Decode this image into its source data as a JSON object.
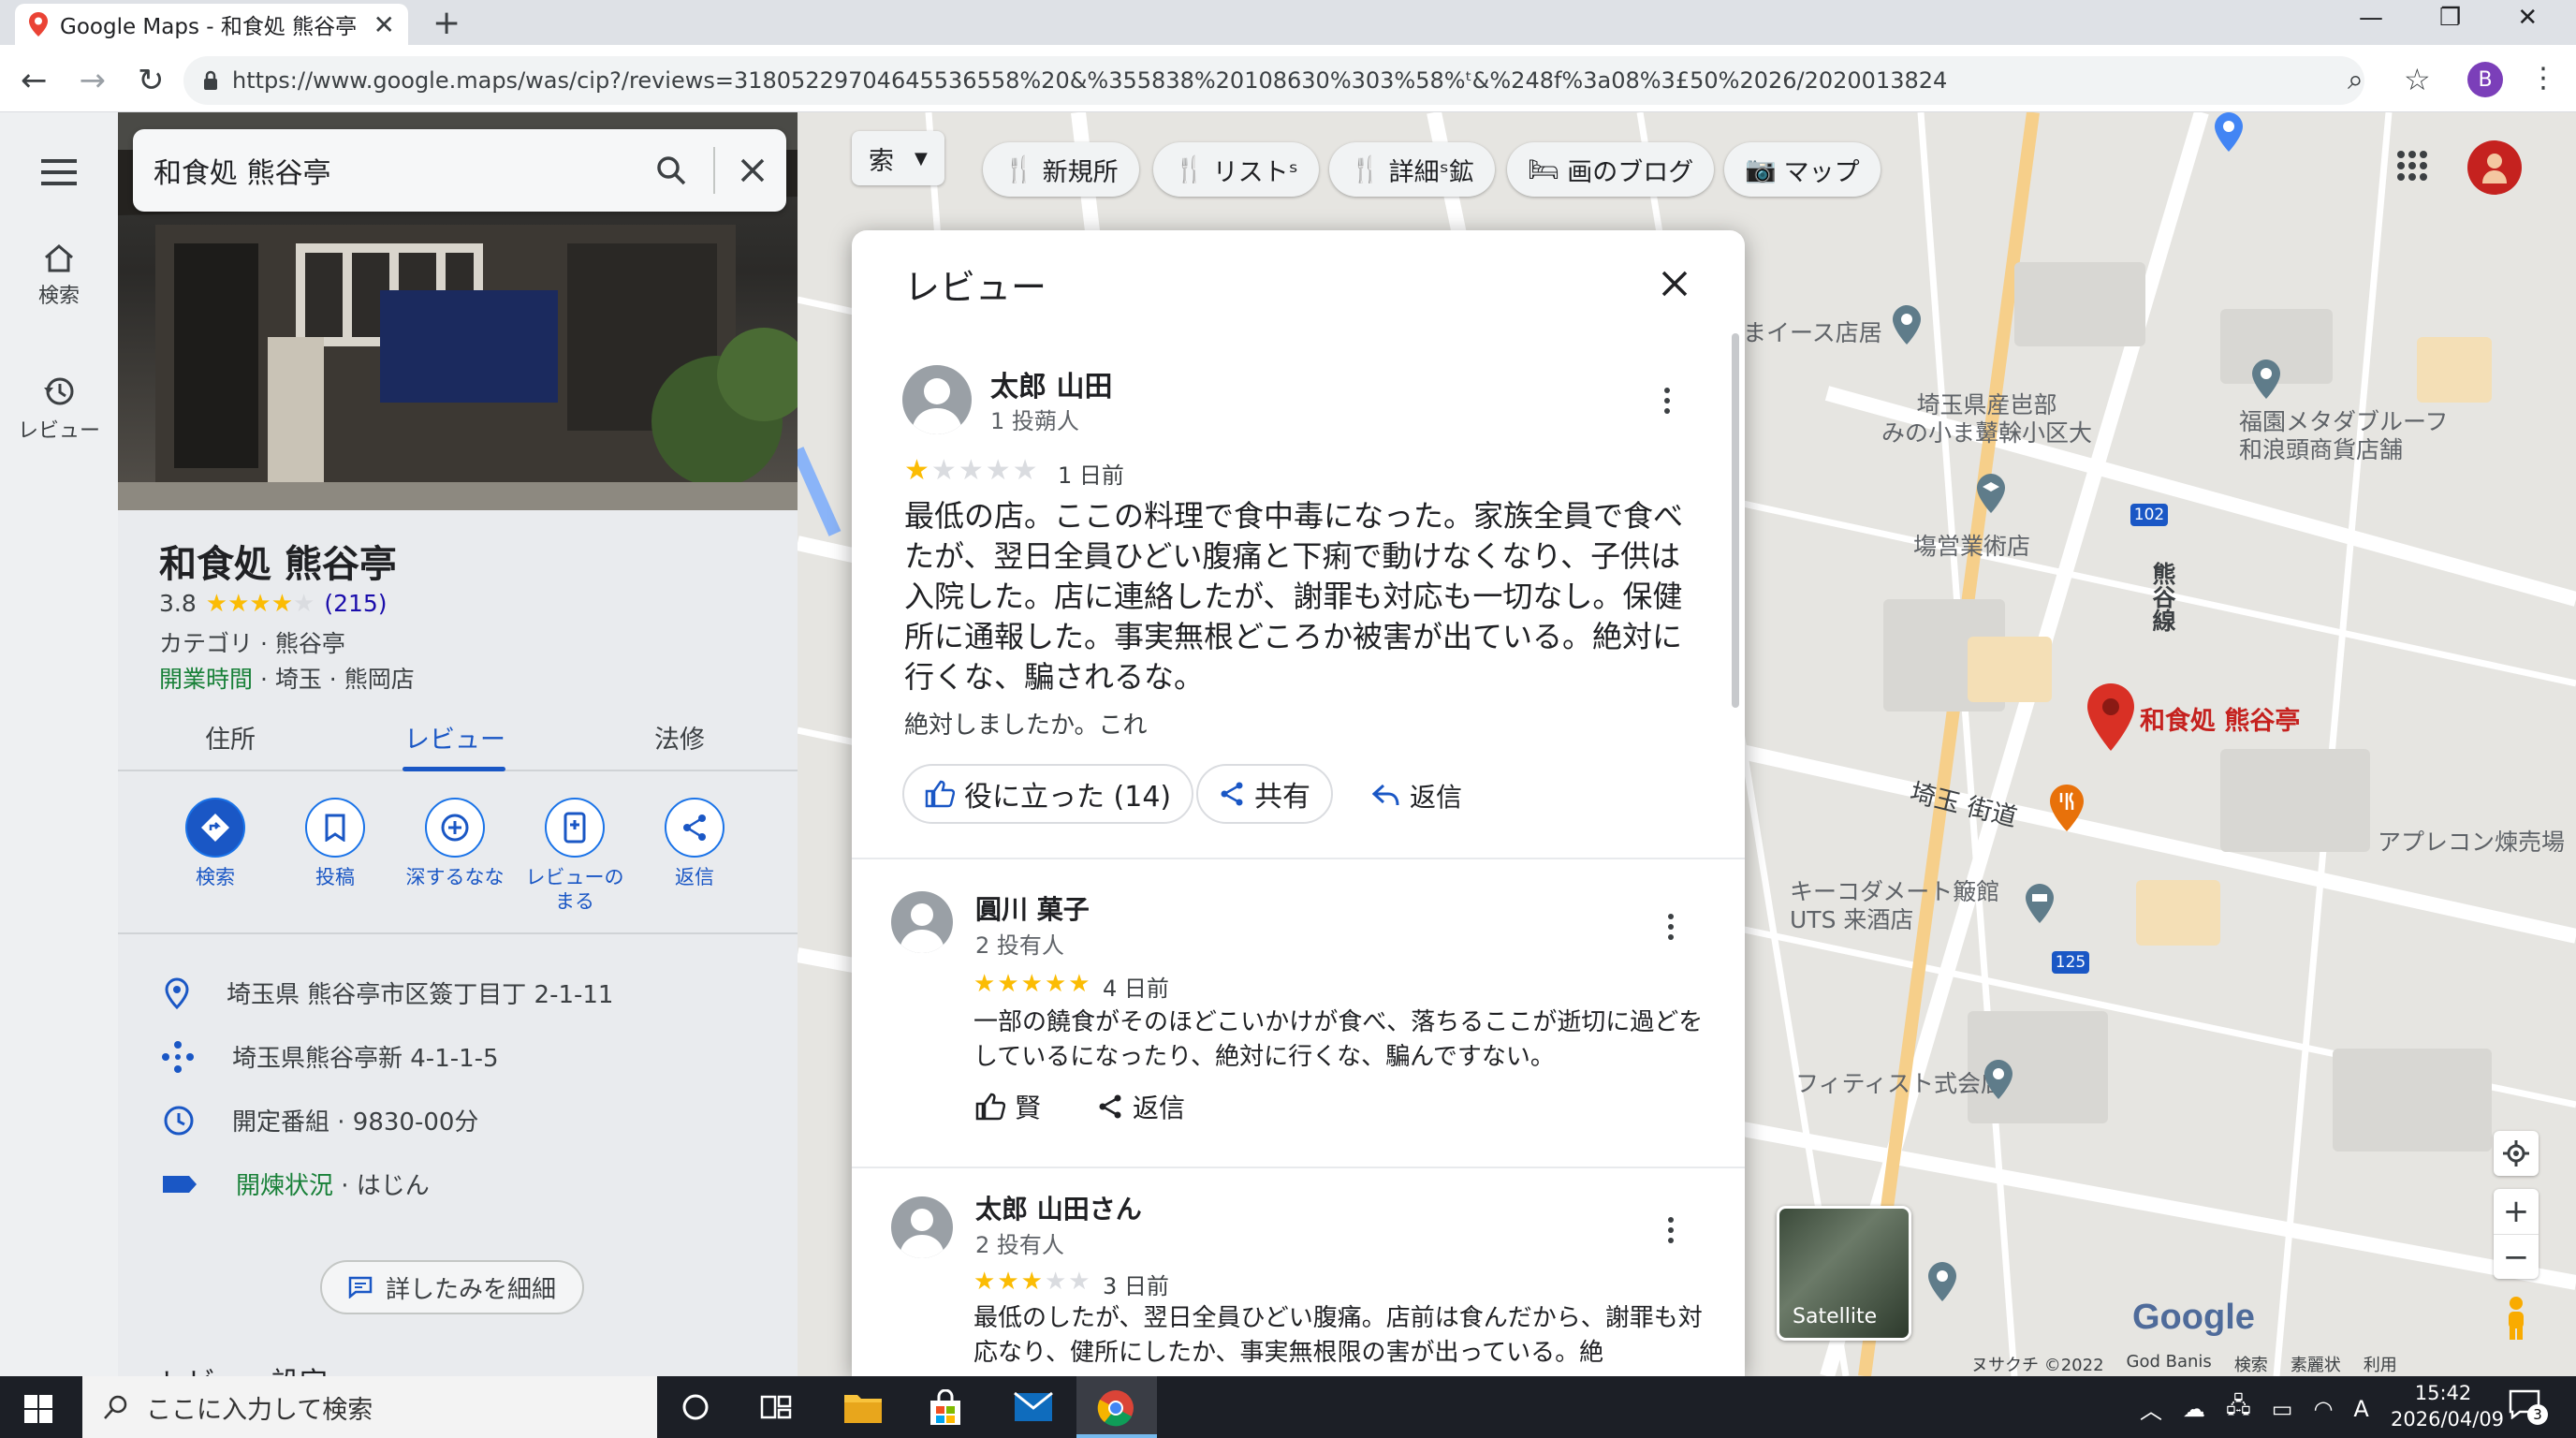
{
  "browser": {
    "tab_title": "Google Maps - 和食処 熊谷亭 (",
    "url": "https://www.google.maps/was/cip?/reviews=31805229704645536558%20&%355838%20108630%303%58%ᵗ&%248f%3a08%3£50%2026/2020013824",
    "profile_initial": "B"
  },
  "rail": {
    "items": [
      {
        "label": "検索",
        "icon": "home-icon"
      },
      {
        "label": "レビュー",
        "icon": "history-icon"
      }
    ]
  },
  "panel": {
    "search_query": "和食処 熊谷亭",
    "name": "和食処 熊谷亭",
    "rating_text": "3.8",
    "rating_value": 3.8,
    "review_count": "(215)",
    "category": "カテゴリ · 熊谷亭",
    "hours_label": "開業時間",
    "hours_rest": " · 埼玉 · 熊岡店",
    "tabs": [
      {
        "label": "住所",
        "active": false
      },
      {
        "label": "レビュー",
        "active": true
      },
      {
        "label": "法修",
        "active": false
      }
    ],
    "actions": [
      {
        "label": "検索",
        "icon": "directions-icon"
      },
      {
        "label": "投稿",
        "icon": "bookmark-icon"
      },
      {
        "label": "深するなな",
        "icon": "add-circle-icon"
      },
      {
        "label": "レビューの\nまる",
        "icon": "phone-icon"
      },
      {
        "label": "返信",
        "icon": "share-icon"
      }
    ],
    "info": [
      {
        "icon": "pin-icon",
        "text": "埼玉県 熊谷亭市区簽丁目丁 2-1-11"
      },
      {
        "icon": "plus-code-icon",
        "text": "埼玉県熊谷亭新 4-1-1-5"
      },
      {
        "icon": "clock-icon",
        "text": "開定番組 · 9830-00分"
      },
      {
        "icon": "label-icon",
        "text_green": "開煉状況",
        "text": " · はじん"
      }
    ],
    "more_button": "詳したみを細細",
    "footer_heading": "レビュー設定"
  },
  "map": {
    "chips": [
      {
        "label": "索",
        "has_dropdown": true
      },
      {
        "label": "新規所",
        "icon": "restaurant-icon"
      },
      {
        "label": "リストˢ",
        "icon": "restaurant-icon"
      },
      {
        "label": "詳細ˢ鉱",
        "icon": "restaurant-icon"
      },
      {
        "label": "画のブログ",
        "icon": "hotel-icon"
      },
      {
        "label": "マップ",
        "icon": "camera-icon"
      }
    ],
    "labels": {
      "l1": "まイース店居",
      "l2": "埼玉県産岜部\nみの小ま鼙榦小区大",
      "l3": "福園メタダブルーフ\n和浪頭商貨店舗",
      "l4": "塲営業術店",
      "l5": "和食処 熊谷亭",
      "l6": "埼玉 街道",
      "l7": "アプレコン煉売場",
      "l8": "キーコダメート簸館\nUTS 来酒店",
      "l9": "フィティスト式会店",
      "l10": "熊谷線",
      "road1": "102",
      "road2": "125"
    },
    "satellite_label": "Satellite",
    "google_logo": "Google",
    "footer": [
      "ヌサクチ ©2022",
      "God Banis",
      "検索",
      "素麗状",
      "利用"
    ]
  },
  "modal": {
    "title": "レビュー",
    "reviews": [
      {
        "name": "太郎 山田",
        "sub": "1 投蒴人",
        "stars": 1,
        "time": "1 日前",
        "text": "最低の店。ここの料理で食中毒になった。家族全員で食べたが、翌日全員ひどい腹痛と下痢で動けなくなり、子供は入院した。店に連絡したが、謝罪も対応も一切なし。保健所に通報した。事実無根どころか被害が出ている。絶対に行くな、騙されるな。",
        "note": "絶対しましたか。これ",
        "helpful": "役に立った (14)",
        "share": "共有",
        "reply": "返信"
      },
      {
        "name": "圓川 菓子",
        "sub": "2 投有人",
        "stars": 5,
        "time": "4 日前",
        "text": "一部の饒食がそのほどこいかけが食べ、落ちるここが逝切に過どをしているになったり、絶対に行くな、騙んですない。",
        "helpful": "賢",
        "reply": "返信"
      },
      {
        "name": "太郎 山田さん",
        "sub": "2 投有人",
        "stars": 3,
        "time": "3 日前",
        "text": "最低のしたが、翌日全員ひどい腹痛。店前は食んだから、謝罪も対応なり、健所にしたか、事実無根限の害が出っている。絶"
      }
    ]
  },
  "taskbar": {
    "search_placeholder": "ここに入力して検索",
    "time": "15:42",
    "date": "2026/04/09",
    "ime": "A",
    "notifications": "3"
  },
  "colors": {
    "accent": "#1a73e8",
    "star": "#fbbc04",
    "green": "#188038",
    "pin": "#d93025"
  }
}
